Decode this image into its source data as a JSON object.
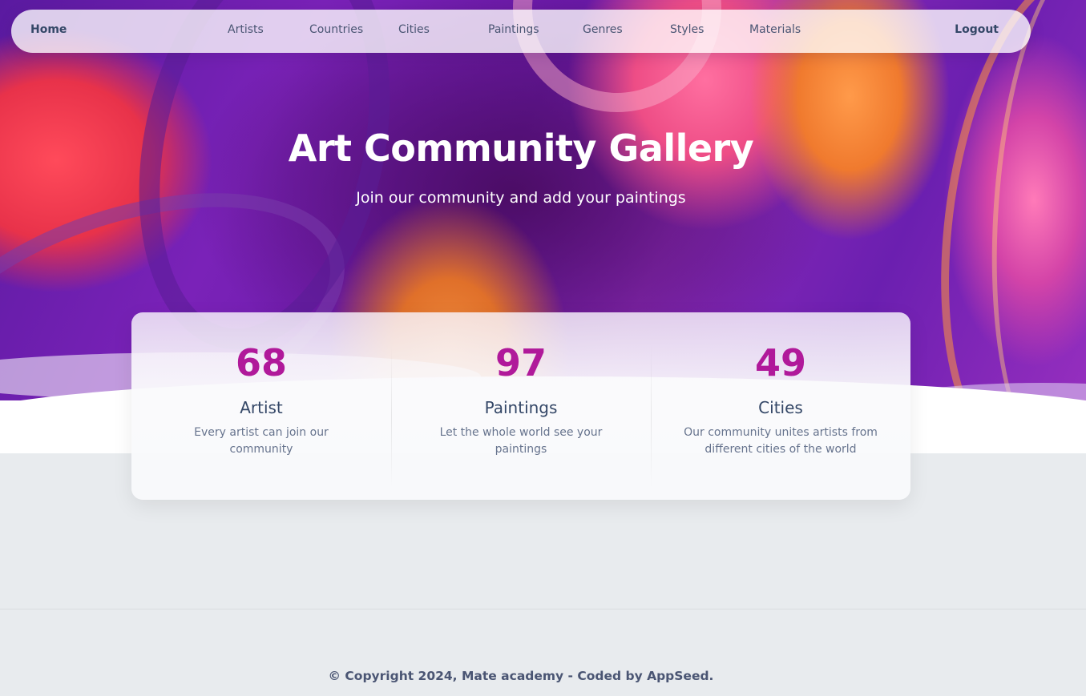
{
  "navbar": {
    "brand": "Home",
    "links": [
      "Artists",
      "Countries",
      "Cities",
      "Paintings",
      "Genres",
      "Styles",
      "Materials"
    ],
    "logout": "Logout"
  },
  "hero": {
    "title": "Art Community Gallery",
    "subtitle": "Join our community and add your paintings"
  },
  "stats": [
    {
      "number": "68",
      "title": "Artist",
      "description": "Every artist can join our community"
    },
    {
      "number": "97",
      "title": "Paintings",
      "description": "Let the whole world see your paintings"
    },
    {
      "number": "49",
      "title": "Cities",
      "description": "Our community unites artists from different cities of the world"
    }
  ],
  "footer": {
    "copyright": "© Copyright 2024, Mate academy - Coded by AppSeed."
  },
  "colors": {
    "accent": "#b0199a",
    "text_dark": "#344767",
    "text_muted": "#67748e",
    "page_bg": "#e8ebee"
  }
}
